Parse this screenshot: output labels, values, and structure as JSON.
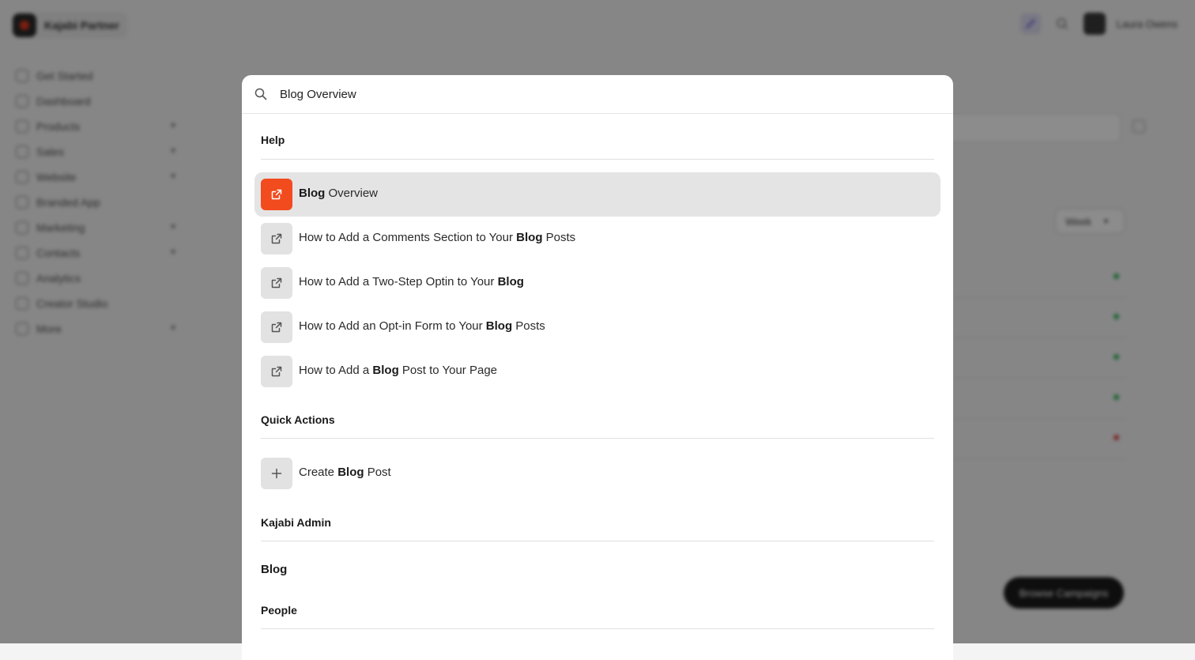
{
  "app": {
    "brand": "Kajabi Partner",
    "user_name": "Laura Owens",
    "sidebar": [
      {
        "label": "Get Started",
        "icon": "rocket-icon",
        "has_chevron": false
      },
      {
        "label": "Dashboard",
        "icon": "home-icon",
        "has_chevron": false
      },
      {
        "label": "Products",
        "icon": "products-icon",
        "has_chevron": true
      },
      {
        "label": "Sales",
        "icon": "sales-icon",
        "has_chevron": true
      },
      {
        "label": "Website",
        "icon": "website-icon",
        "has_chevron": true
      },
      {
        "label": "Branded App",
        "icon": "phone-icon",
        "has_chevron": false
      },
      {
        "label": "Marketing",
        "icon": "marketing-icon",
        "has_chevron": true
      },
      {
        "label": "Contacts",
        "icon": "contacts-icon",
        "has_chevron": true
      },
      {
        "label": "Analytics",
        "icon": "analytics-icon",
        "has_chevron": false
      },
      {
        "label": "Creator Studio",
        "icon": "studio-icon",
        "has_chevron": false
      },
      {
        "label": "More",
        "icon": "more-icon",
        "has_chevron": true
      }
    ],
    "week_select": "Week",
    "browse_button": "Browse Campaigns"
  },
  "palette": {
    "search_value": "Blog Overview",
    "accent_color": "#f24b1e",
    "sections": {
      "help": "Help",
      "quick_actions": "Quick Actions",
      "kajabi_admin": "Kajabi Admin",
      "people": "People"
    },
    "help_results": [
      {
        "parts": [
          {
            "t": "Blog",
            "b": true
          },
          {
            "t": " Overview",
            "b": false
          }
        ],
        "selected": true,
        "icon": "external-link-icon"
      },
      {
        "parts": [
          {
            "t": "How to Add a Comments Section to Your ",
            "b": false
          },
          {
            "t": "Blog",
            "b": true
          },
          {
            "t": " Posts",
            "b": false
          }
        ],
        "selected": false,
        "icon": "external-link-icon"
      },
      {
        "parts": [
          {
            "t": "How to Add a Two-Step Optin to Your ",
            "b": false
          },
          {
            "t": "Blog",
            "b": true
          }
        ],
        "selected": false,
        "icon": "external-link-icon"
      },
      {
        "parts": [
          {
            "t": "How to Add an Opt-in Form to Your ",
            "b": false
          },
          {
            "t": "Blog",
            "b": true
          },
          {
            "t": " Posts",
            "b": false
          }
        ],
        "selected": false,
        "icon": "external-link-icon"
      },
      {
        "parts": [
          {
            "t": "How to Add a ",
            "b": false
          },
          {
            "t": "Blog",
            "b": true
          },
          {
            "t": " Post to Your Page",
            "b": false
          }
        ],
        "selected": false,
        "icon": "external-link-icon"
      }
    ],
    "quick_action_results": [
      {
        "parts": [
          {
            "t": "Create ",
            "b": false
          },
          {
            "t": "Blog",
            "b": true
          },
          {
            "t": " Post",
            "b": false
          }
        ],
        "icon": "plus-icon"
      }
    ],
    "admin_items": [
      "Blog"
    ]
  }
}
